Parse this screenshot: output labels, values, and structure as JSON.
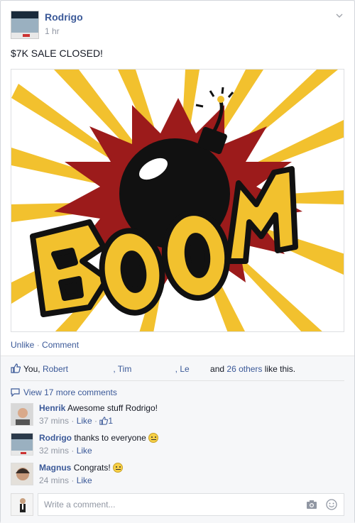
{
  "post": {
    "author": "Rodrigo",
    "time": "1 hr",
    "text": "$7K SALE CLOSED!",
    "image_text": "BOOM"
  },
  "actions": {
    "unlike": "Unlike",
    "separator": " · ",
    "comment": "Comment"
  },
  "likes": {
    "you": "You,",
    "name1": "Robert",
    "name2": ", Tim",
    "name3": ", Le",
    "and": "and",
    "others": "26 others",
    "suffix": "like this."
  },
  "comments": {
    "view_more": "View 17 more comments",
    "items": [
      {
        "name": "Henrik",
        "text": "Awesome stuff Rodrigo!",
        "time": "37 mins",
        "like": "Like",
        "likes": "1"
      },
      {
        "name": "Rodrigo",
        "text": "thanks to everyone",
        "time": "32 mins",
        "like": "Like"
      },
      {
        "name": "Magnus",
        "text": "Congrats!",
        "time": "24 mins",
        "like": "Like"
      }
    ],
    "placeholder": "Write a comment..."
  },
  "colors": {
    "link": "#3b5998",
    "meta": "#9197a3",
    "boom_yellow": "#f2c12e",
    "boom_red": "#9c1b1b"
  }
}
